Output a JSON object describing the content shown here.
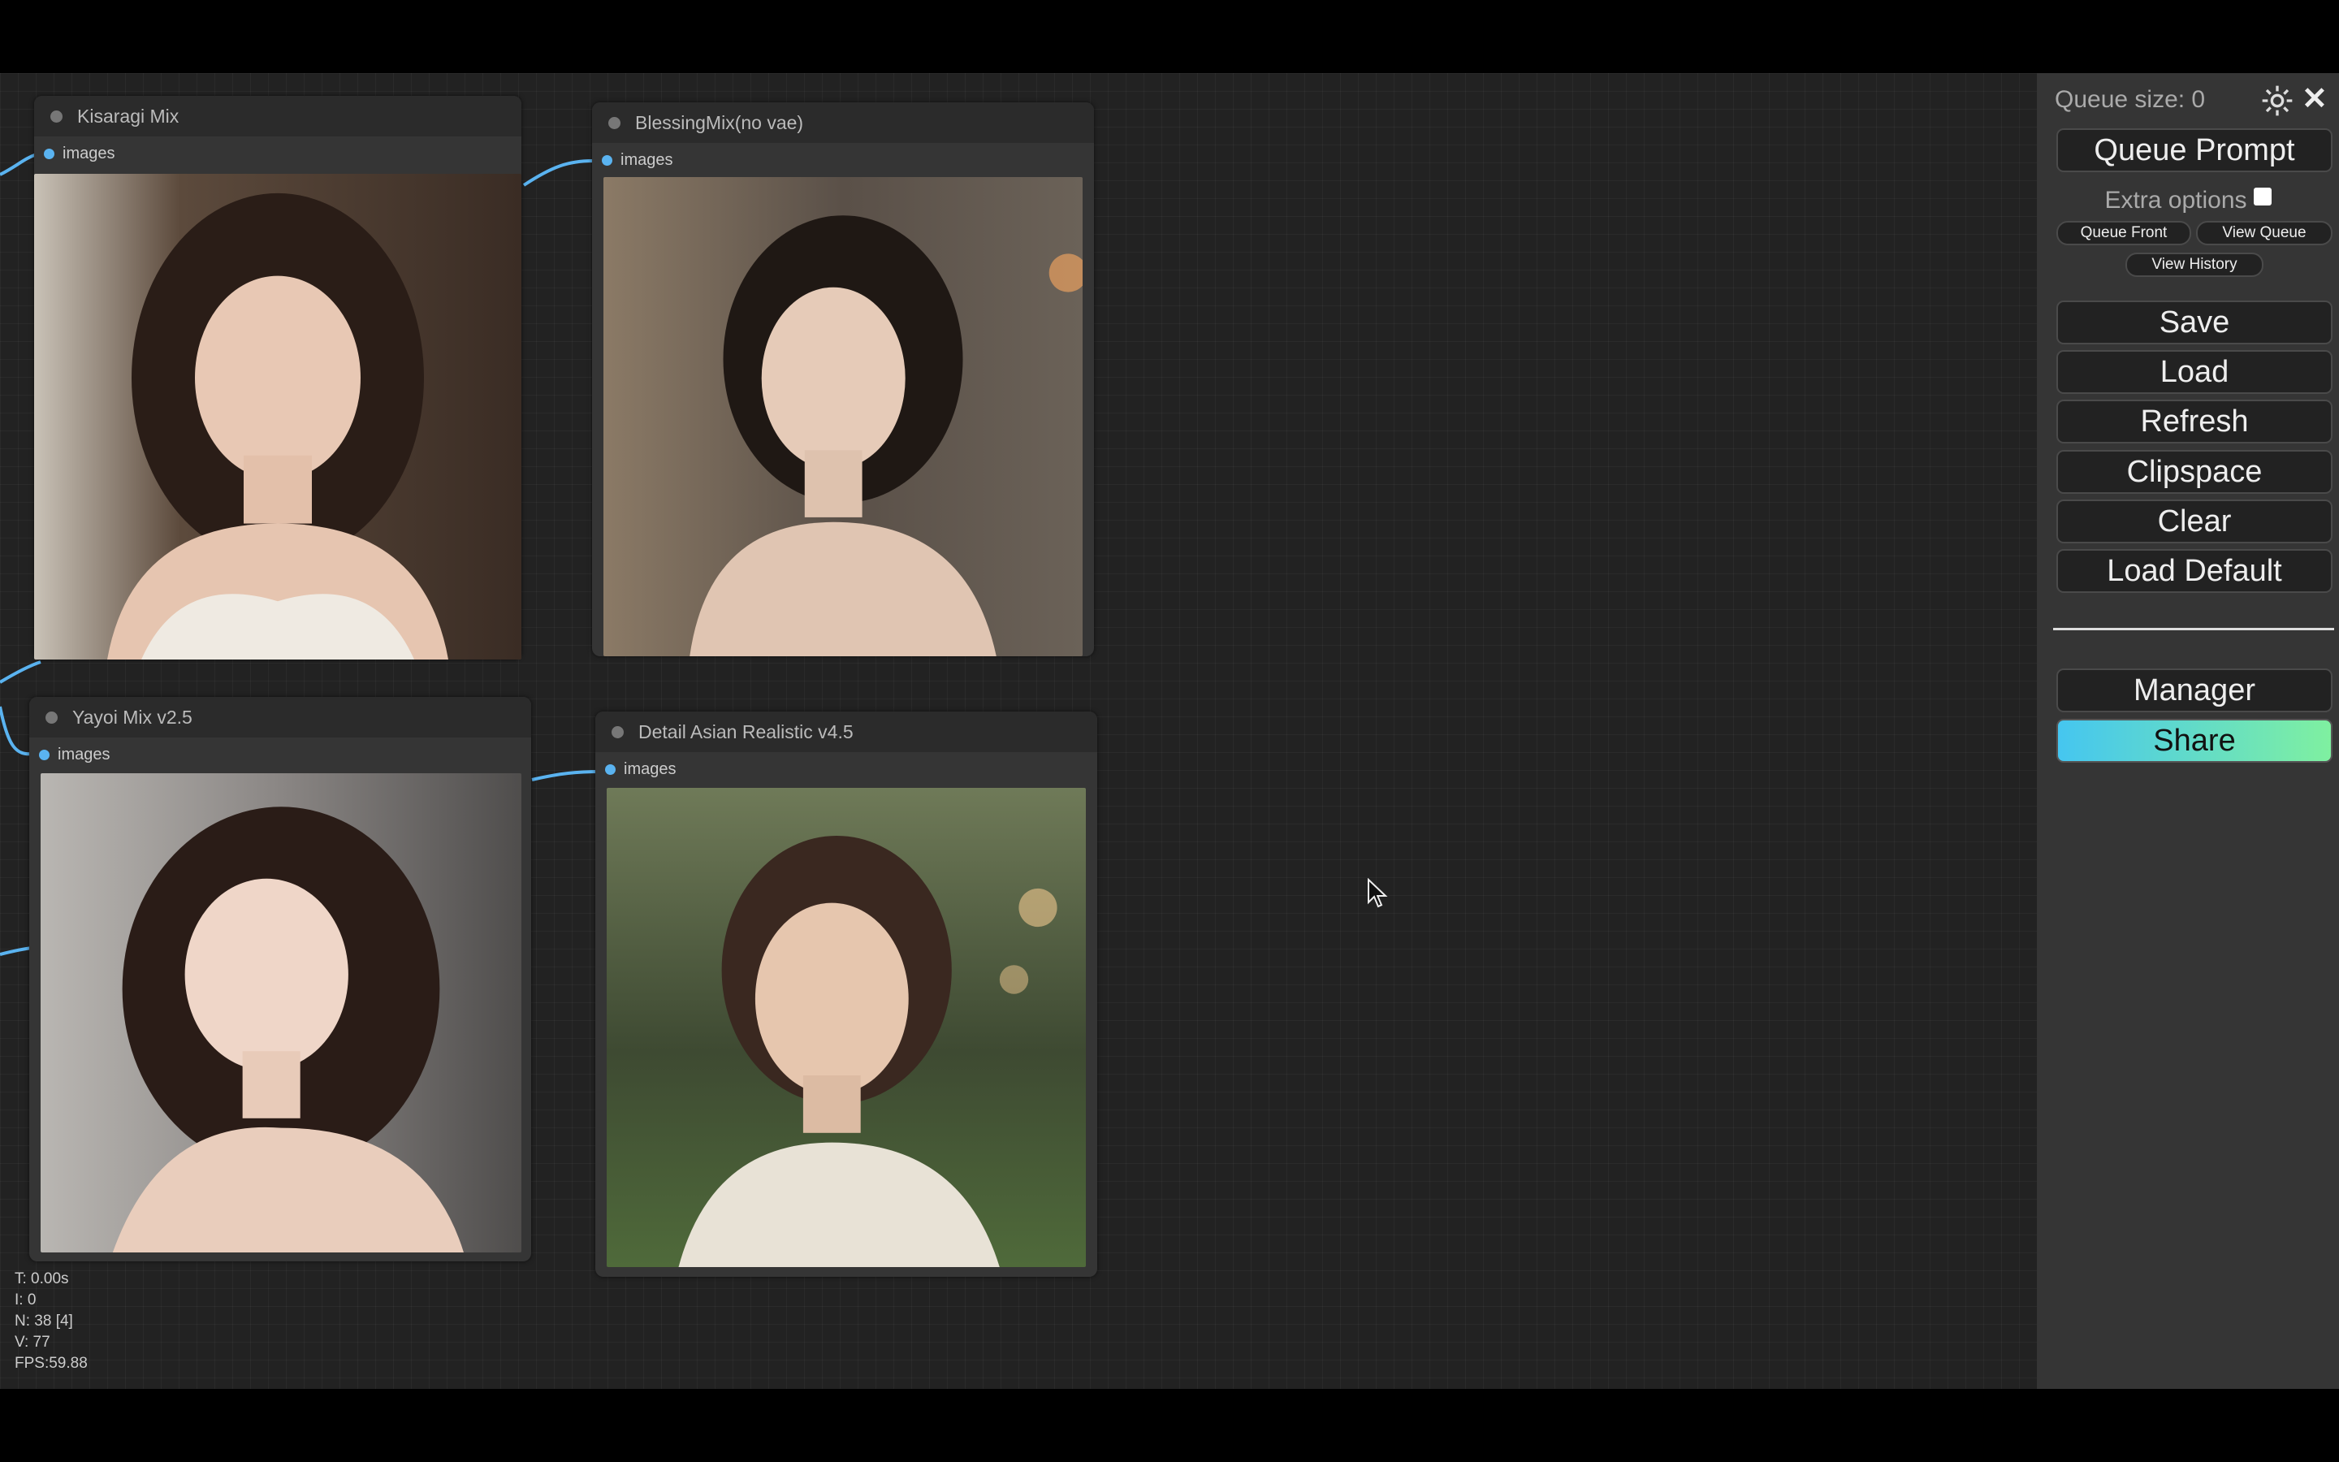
{
  "nodes": [
    {
      "title": "Kisaragi Mix",
      "slot": "images"
    },
    {
      "title": "BlessingMix(no vae)",
      "slot": "images"
    },
    {
      "title": "Yayoi Mix v2.5",
      "slot": "images"
    },
    {
      "title": "Detail Asian Realistic v4.5",
      "slot": "images"
    }
  ],
  "stats": {
    "t": "T: 0.00s",
    "i": "I: 0",
    "n": "N: 38 [4]",
    "v": "V: 77",
    "fps": "FPS:59.88"
  },
  "panel": {
    "queue_size": "Queue size: 0",
    "queue_prompt": "Queue Prompt",
    "extra_options": "Extra options",
    "queue_front": "Queue Front",
    "view_queue": "View Queue",
    "view_history": "View History",
    "save": "Save",
    "load": "Load",
    "refresh": "Refresh",
    "clipspace": "Clipspace",
    "clear": "Clear",
    "load_default": "Load Default",
    "manager": "Manager",
    "share": "Share"
  },
  "colors": {
    "slot": "#5ab3f0",
    "link": "#5ab3f0",
    "share_start": "#45c6f0",
    "share_end": "#7ff0a0"
  }
}
